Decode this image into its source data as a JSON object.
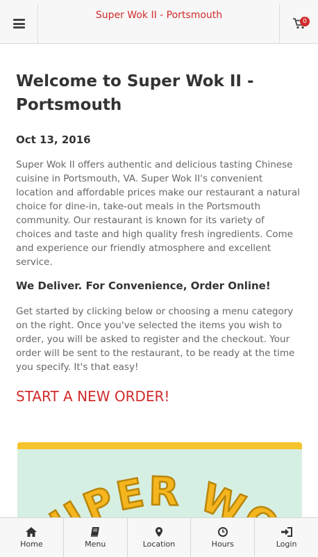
{
  "header": {
    "title": "Super Wok II - Portsmouth",
    "cart_count": "0",
    "menu_icon": "hamburger-icon",
    "cart_icon": "shopping-cart-icon"
  },
  "main": {
    "heading": "Welcome to Super Wok II - Portsmouth",
    "date": "Oct 13, 2016",
    "intro": "Super Wok II offers authentic and delicious tasting Chinese cuisine in Portsmouth, VA. Super Wok II's convenient location and affordable prices make our restaurant a natural choice for dine-in, take-out meals in the Portsmouth community. Our restaurant is known for its variety of choices and taste and high quality fresh ingredients. Come and experience our friendly atmosphere and excellent service.",
    "subheading": "We Deliver. For Convenience, Order Online!",
    "instructions": "Get started by clicking below or choosing a menu category on the right. Once you've selected the items you wish to order, you will be asked to register and the checkout. Your order will be sent to the restaurant, to be ready at the time you specify. It's that easy!",
    "start_order": "START A NEW ORDER!"
  },
  "banner": {
    "text": "UPER WO"
  },
  "nav": {
    "items": [
      {
        "label": "Home",
        "icon": "home-icon"
      },
      {
        "label": "Menu",
        "icon": "book-icon"
      },
      {
        "label": "Location",
        "icon": "map-marker-icon"
      },
      {
        "label": "Hours",
        "icon": "clock-icon"
      },
      {
        "label": "Login",
        "icon": "login-icon"
      }
    ]
  },
  "colors": {
    "brand_red": "#d12b2b",
    "banner_yellow": "#f5c32c",
    "banner_bg": "#d6efe3"
  }
}
